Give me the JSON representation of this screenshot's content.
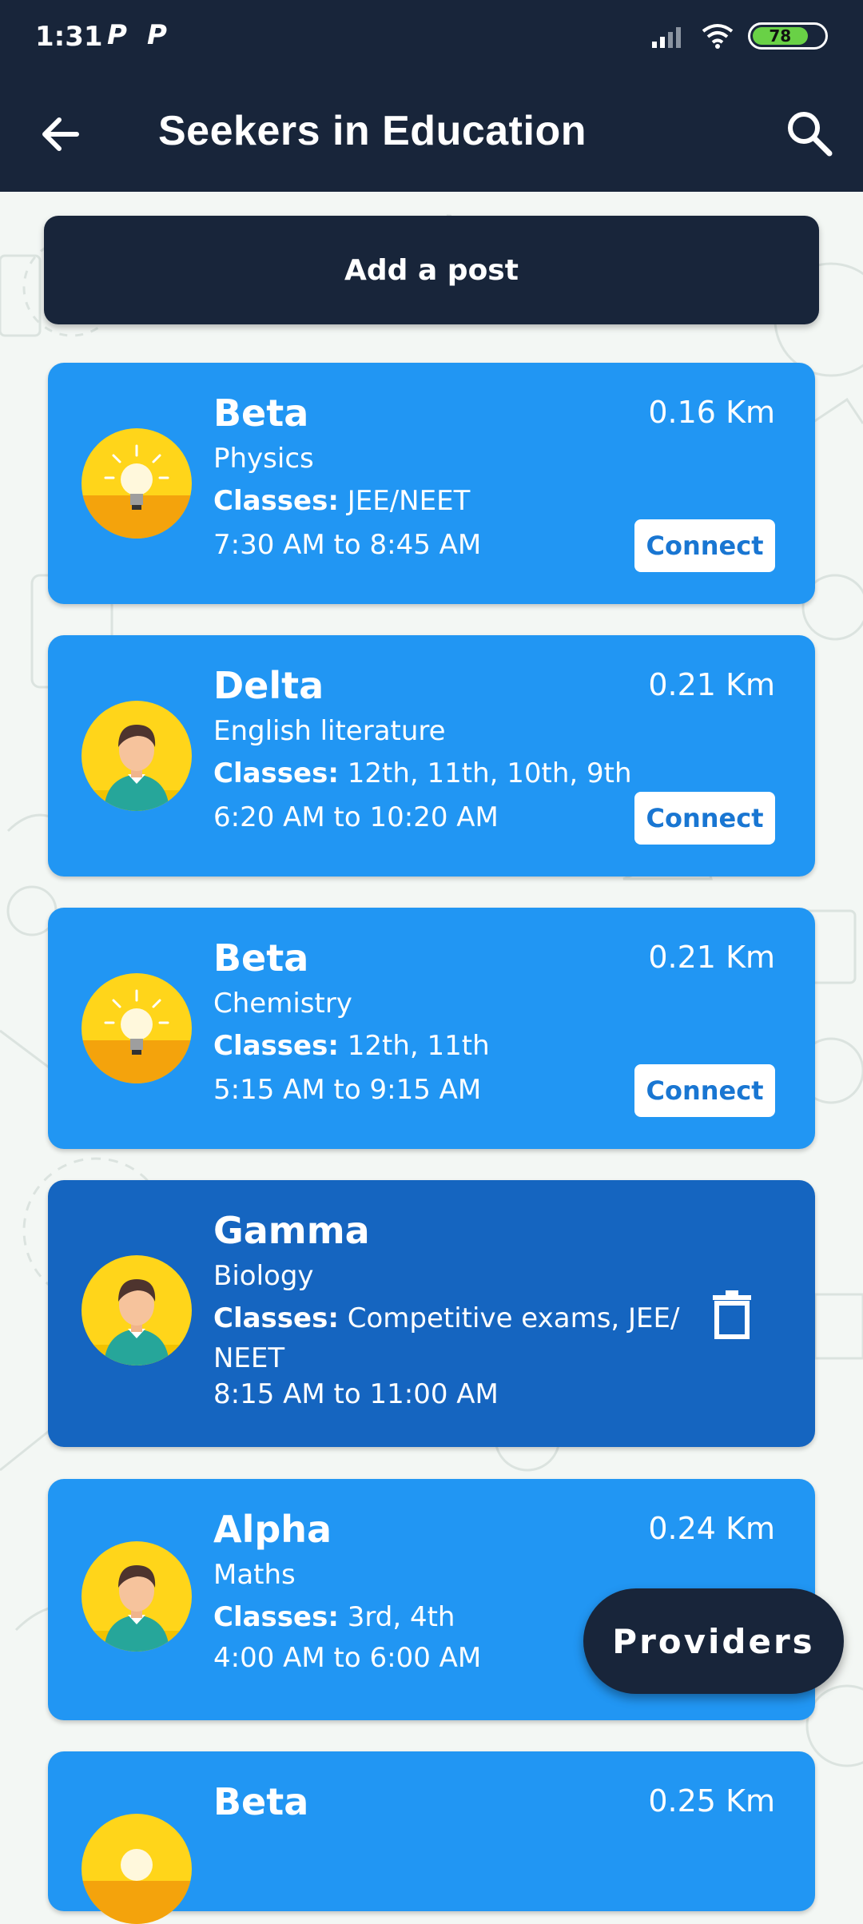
{
  "status_bar": {
    "time": "1:31",
    "notif_icons": [
      "P",
      "P"
    ],
    "battery": "78",
    "battery_level": 0.78
  },
  "app_bar": {
    "title": "Seekers in Education",
    "back_icon": "arrow-left-icon",
    "search_icon": "search-icon"
  },
  "add_post_label": "Add a post",
  "classes_label": "Classes:",
  "connect_label": "Connect",
  "posts": [
    {
      "name": "Beta",
      "subject": "Physics",
      "classes": "JEE/NEET",
      "time": "7:30 AM to 8:45 AM",
      "distance": "0.16 Km",
      "avatar": "lightbulb-icon"
    },
    {
      "name": "Delta",
      "subject": "English literature",
      "classes": "12th, 11th, 10th, 9th",
      "time": "6:20 AM to 10:20 AM",
      "distance": "0.21 Km",
      "avatar": "person-icon"
    },
    {
      "name": "Beta",
      "subject": "Chemistry",
      "classes": "12th, 11th",
      "time": "5:15 AM to 9:15 AM",
      "distance": "0.21 Km",
      "avatar": "lightbulb-icon"
    },
    {
      "name": "Gamma",
      "subject": "Biology",
      "classes": "Competitive exams, JEE/",
      "classes_line2": "NEET",
      "time": "8:15 AM to 11:00 AM",
      "avatar": "person-icon",
      "action": "delete-icon"
    },
    {
      "name": "Alpha",
      "subject": "Maths",
      "classes": "3rd, 4th",
      "time": "4:00 AM to 6:00 AM",
      "distance": "0.24 Km",
      "avatar": "person-icon"
    },
    {
      "name": "Beta",
      "distance": "0.25 Km",
      "avatar": "lightbulb-icon"
    }
  ],
  "fab_label": "Providers",
  "colors": {
    "dark": "#18253a",
    "card": "#2196f3",
    "own_card": "#1565c0",
    "avatar_bg": "#ffd51a"
  }
}
